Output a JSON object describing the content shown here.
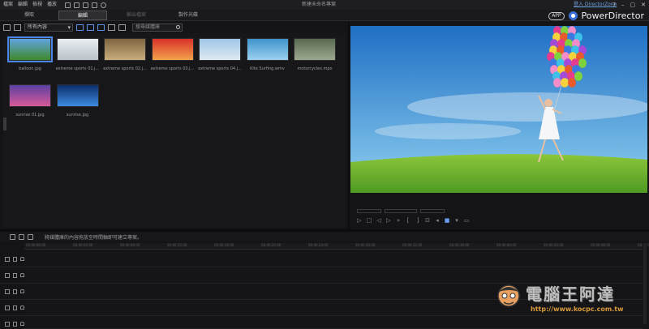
{
  "titlebar": {
    "menu": [
      "檔案",
      "編輯",
      "檢視",
      "播放"
    ],
    "window_title": "新建未命名專案",
    "directorzone_link": "登入 DirectorZone",
    "controls": [
      "?",
      "–",
      "▢",
      "✕"
    ]
  },
  "tabs": [
    {
      "label": "擷取",
      "state": "normal"
    },
    {
      "label": "編輯",
      "state": "active"
    },
    {
      "label": "輸出檔案",
      "state": "disabled"
    },
    {
      "label": "製作光碟",
      "state": "normal"
    }
  ],
  "brand": {
    "app_badge": "APP",
    "name": "PowerDirector"
  },
  "library_toolbar": {
    "filter_value": "所有內容",
    "search_placeholder": "搜尋媒體庫"
  },
  "media": [
    {
      "label": "balloon.jpg",
      "colors": [
        "#5fa3e0",
        "#3e8a2a"
      ],
      "selected": true
    },
    {
      "label": "extreme sports 01.j...",
      "colors": [
        "#e9eef2",
        "#b9c2c8"
      ],
      "selected": false
    },
    {
      "label": "extreme sports 02.j...",
      "colors": [
        "#7e6540",
        "#c8ae7c"
      ],
      "selected": false
    },
    {
      "label": "extreme sports 03.j...",
      "colors": [
        "#d8322a",
        "#f2a24a"
      ],
      "selected": false
    },
    {
      "label": "extreme sports 04.j...",
      "colors": [
        "#9fc6e6",
        "#dfeaf2"
      ],
      "selected": false
    },
    {
      "label": "Kite Surfing.wmv",
      "colors": [
        "#3f94cc",
        "#9bd0ee"
      ],
      "selected": false
    },
    {
      "label": "motorcycles.mpo",
      "colors": [
        "#5a6a52",
        "#9ba88e"
      ],
      "selected": false
    },
    {
      "label": "sunrise 01.jpg",
      "colors": [
        "#5b3fa0",
        "#d85a9a"
      ],
      "selected": false
    },
    {
      "label": "sunrise.jpg",
      "colors": [
        "#0d2e6a",
        "#3c8ae0"
      ],
      "selected": false
    }
  ],
  "preview": {
    "sky_top": "#1f6fc4",
    "sky_bottom": "#8fd0f0",
    "grass": "#4f9a24",
    "balloon_colors": [
      "#e63a8e",
      "#f4d23c",
      "#3ec1e8",
      "#7ed23c",
      "#e85a2a",
      "#a44ad8",
      "#f48cc8",
      "#3a7ae0"
    ]
  },
  "timeline": {
    "hint": "將媒體庫的內容拖放至時間軸即可建立專案。",
    "ticks": [
      "00;00;00;00",
      "00;00;04;00",
      "00;00;08;00",
      "00;00;12;00",
      "00;00;16;00",
      "00;00;20;00",
      "00;00;24;00",
      "00;00;28;00",
      "00;00;32;00",
      "00;00;36;00",
      "00;00;40;00",
      "00;00;44;00",
      "00;00;48;00",
      "00;00;52;00"
    ]
  },
  "watermark": {
    "text": "電腦王阿達",
    "url": "http://www.kocpc.com.tw"
  }
}
